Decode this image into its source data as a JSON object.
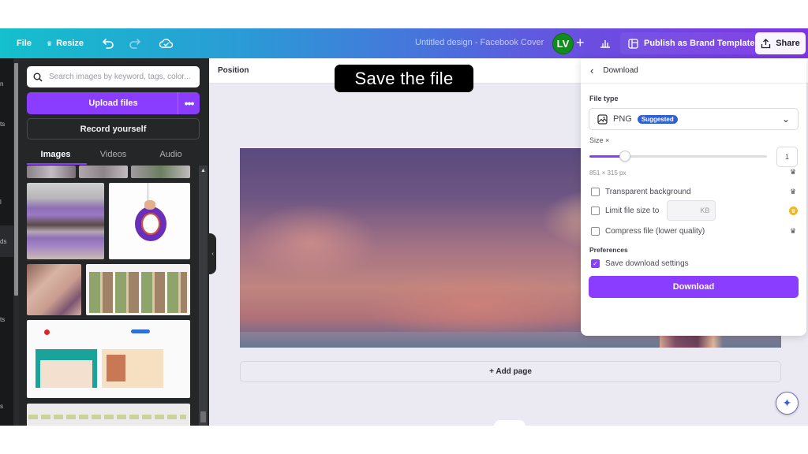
{
  "topbar": {
    "file_label": "File",
    "resize_label": "Resize",
    "design_title": "Untitled design - Facebook Cover",
    "avatar_initials": "LV",
    "add_collaborator": "+",
    "publish_label": "Publish as Brand Template",
    "share_label": "Share"
  },
  "rail": {
    "items": [
      "n",
      "ts",
      "l",
      "ds",
      "ts",
      "s"
    ]
  },
  "panel": {
    "search_placeholder": "Search images by keyword, tags, color...",
    "upload_label": "Upload files",
    "more_label": "•••",
    "record_label": "Record yourself",
    "tabs": [
      {
        "label": "Images",
        "active": true
      },
      {
        "label": "Videos",
        "active": false
      },
      {
        "label": "Audio",
        "active": false
      }
    ],
    "images": [
      "jewelry-thumb-1",
      "jewelry-thumb-2",
      "jewelry-thumb-3",
      "amethyst-bracelet",
      "butterfly-pendant",
      "wrist-bracelet",
      "pinterest-food-grid",
      "save-to-pinterest-page",
      "browser-screenshot"
    ]
  },
  "canvas": {
    "context_label": "Position",
    "banner_text": "Save the file",
    "add_page_label": "+ Add page"
  },
  "download": {
    "title": "Download",
    "file_type_label": "File type",
    "file_type_value": "PNG",
    "suggested_badge": "Suggested",
    "size_label": "Size ×",
    "size_value": "1",
    "size_slider_fraction": 0.2,
    "dimensions": "851 × 315 px",
    "options": [
      {
        "label": "Transparent background",
        "checked": false,
        "pro": true
      },
      {
        "label": "Limit file size to",
        "checked": false,
        "pro": true,
        "unit": "KB"
      },
      {
        "label": "Compress file (lower quality)",
        "checked": false,
        "pro": true
      }
    ],
    "preferences_label": "Preferences",
    "save_settings_label": "Save download settings",
    "save_settings_checked": true,
    "button_label": "Download"
  },
  "colors": {
    "accent": "#8b3dff",
    "badge": "#2f5fd8",
    "avatar": "#128a1e"
  }
}
